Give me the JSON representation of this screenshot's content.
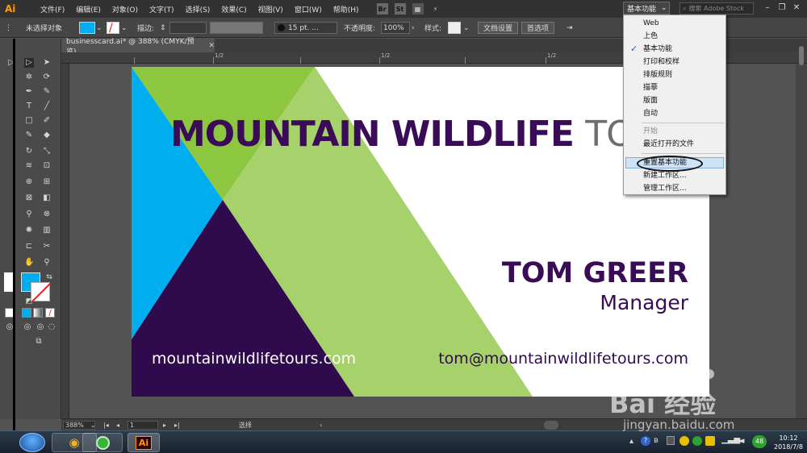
{
  "app": {
    "logo": "Ai"
  },
  "menubar": {
    "items": [
      "文件(F)",
      "编辑(E)",
      "对象(O)",
      "文字(T)",
      "选择(S)",
      "效果(C)",
      "视图(V)",
      "窗口(W)",
      "帮助(H)"
    ],
    "br_label": "Br",
    "st_label": "St"
  },
  "workspace": {
    "label": "基本功能"
  },
  "search": {
    "placeholder": "搜索 Adobe Stock"
  },
  "controlbar": {
    "no_selection": "未选择对象",
    "stroke_label": "描边:",
    "brush_size": "15 pt. ...",
    "opacity_label": "不透明度:",
    "opacity_value": "100%",
    "style_label": "样式:",
    "doc_settings": "文档设置",
    "preferences": "首选项"
  },
  "document": {
    "tab_title": "businesscard.ai* @ 388% (CMYK/预览)",
    "ruler_label": "1/2"
  },
  "card": {
    "headline_bold": "MOUNTAIN WILDLIFE",
    "headline_light": "TOURS",
    "name": "TOM GREER",
    "role": "Manager",
    "website": "mountainwildlifetours.com",
    "email": "tom@mountainwildlifetours.com",
    "colors": {
      "cyan": "#00aeef",
      "green": "#8dc63f",
      "light_green": "#a7d16b",
      "purple": "#2f0a4d"
    }
  },
  "dropdown": {
    "items": [
      "Web",
      "上色",
      "基本功能",
      "打印和校样",
      "排版规则",
      "描摹",
      "版面",
      "自动"
    ],
    "checked_index": 2,
    "section_items": [
      "开始",
      "最近打开的文件"
    ],
    "reset": "重置基本功能",
    "new_workspace": "新建工作区...",
    "manage_workspace": "管理工作区..."
  },
  "statusbar": {
    "zoom": "388%",
    "page": "1",
    "tool": "选择"
  },
  "taskbar": {
    "ai_label": "Ai",
    "badge": "48",
    "time": "10:12",
    "date": "2018/7/8"
  },
  "watermark": {
    "brand": "Bai 经验",
    "url": "jingyan.baidu.com"
  }
}
